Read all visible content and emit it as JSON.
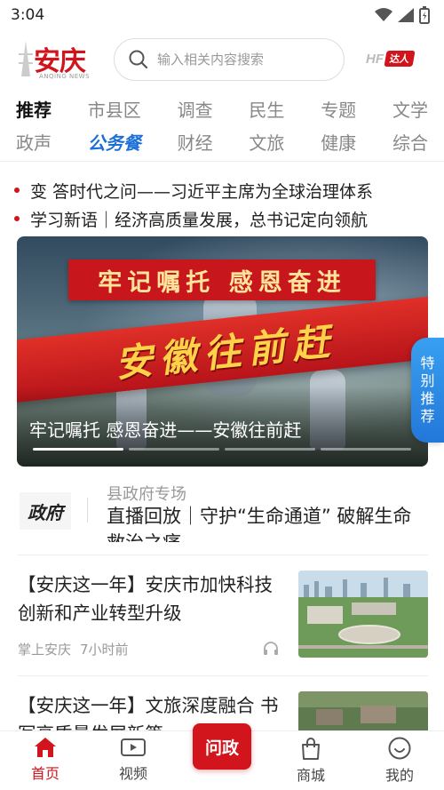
{
  "status_bar": {
    "time": "3:04"
  },
  "header": {
    "logo_text": "安庆",
    "logo_sub": "ANQING NEWS",
    "search_placeholder": "输入相关内容搜索",
    "hf_logo": "HF",
    "hf_tag": "达人"
  },
  "channels": {
    "row1": [
      "推荐",
      "市县区",
      "调查",
      "民生",
      "专题",
      "文学"
    ],
    "row2": [
      "政声",
      "公务餐",
      "财经",
      "文旅",
      "健康",
      "综合"
    ],
    "active": "推荐",
    "special": "公务餐"
  },
  "ticker": [
    "变 答时代之问——习近平主席为全球治理体系",
    "学习新语｜经济高质量发展，总书记定向领航"
  ],
  "banner": {
    "top_slogan": "牢记嘱托 感恩奋进",
    "ribbon_text": "安徽往前赶",
    "caption": "牢记嘱托 感恩奋进——安徽往前赶",
    "pages": 4,
    "active_page": 1
  },
  "float_tab": {
    "label": [
      "特",
      "别",
      "推",
      "荐"
    ]
  },
  "special_card": {
    "logo": "政府",
    "tag": "县政府专场",
    "text": "直播回放｜守护“生命通道” 破解生命救治之痛"
  },
  "news": [
    {
      "title": "【安庆这一年】安庆市加快科技创新和产业转型升级",
      "source": "掌上安庆",
      "time": "7小时前"
    },
    {
      "title": "【安庆这一年】文旅深度融合 书写高质量发展新篇",
      "source": "",
      "time": ""
    }
  ],
  "bottom_nav": {
    "home": "首页",
    "video": "视频",
    "center": "问政",
    "mall": "商城",
    "mine": "我的"
  },
  "colors": {
    "brand_red": "#d2141c",
    "accent_blue": "#1c6fd8"
  }
}
